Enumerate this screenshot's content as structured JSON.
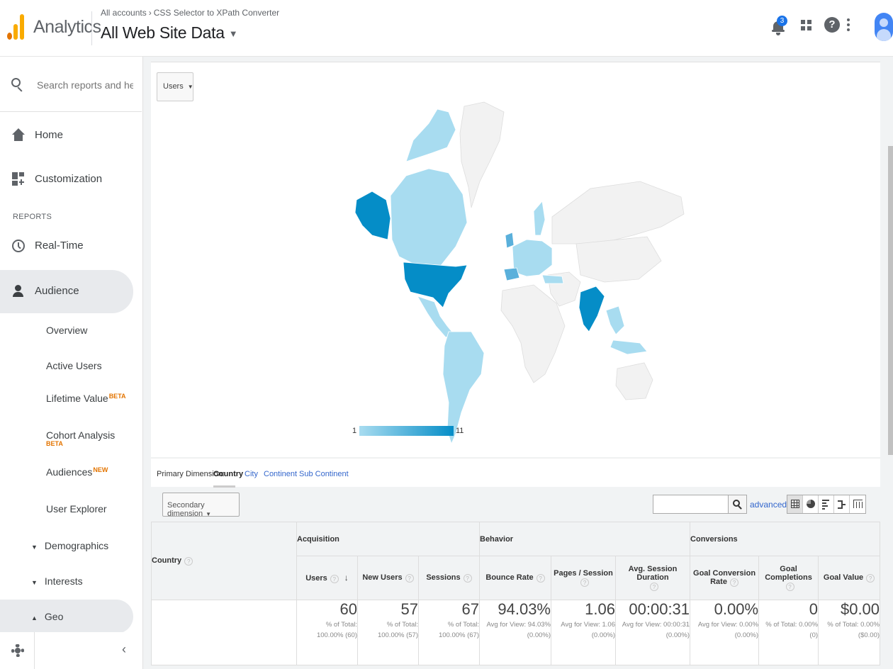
{
  "header": {
    "brand": "Analytics",
    "breadcrumb": [
      "All accounts",
      "CSS Selector to XPath Converter"
    ],
    "breadcrumb_separator": "›",
    "property": "All Web Site Data",
    "notification_count": "3",
    "help_glyph": "?"
  },
  "sidebar": {
    "search_placeholder": "Search reports and help",
    "home": "Home",
    "customization": "Customization",
    "reports_label": "REPORTS",
    "realtime": "Real-Time",
    "audience": "Audience",
    "items": {
      "overview": "Overview",
      "active_users": "Active Users",
      "lifetime_value": "Lifetime Value",
      "lifetime_value_badge": "BETA",
      "cohort_analysis": "Cohort Analysis",
      "cohort_badge": "BETA",
      "audiences": "Audiences",
      "audiences_badge": "NEW",
      "user_explorer": "User Explorer",
      "demographics": "Demographics",
      "interests": "Interests",
      "geo": "Geo"
    },
    "collapse_glyph": "‹"
  },
  "map": {
    "metric": "Users",
    "legend_min": "1",
    "legend_max": "11",
    "colors": {
      "low": "#a8dcf0",
      "high": "#058dc7",
      "none": "#f2f2f2",
      "mid": "#5ab0db"
    }
  },
  "dimension_bar": {
    "label": "Primary Dimension:",
    "current": "Country",
    "options": [
      "City",
      "Continent",
      "Sub Continent"
    ]
  },
  "tools": {
    "secondary_dimension": "Secondary dimension",
    "advanced": "advanced"
  },
  "table": {
    "country_header": "Country",
    "groups": [
      "Acquisition",
      "Behavior",
      "Conversions"
    ],
    "columns": [
      "Users",
      "New Users",
      "Sessions",
      "Bounce Rate",
      "Pages / Session",
      "Avg. Session Duration",
      "Goal Conversion Rate",
      "Goal Completions",
      "Goal Value"
    ],
    "totals": [
      {
        "value": "60",
        "sub1": "% of Total:",
        "sub2": "100.00% (60)"
      },
      {
        "value": "57",
        "sub1": "% of Total:",
        "sub2": "100.00% (57)"
      },
      {
        "value": "67",
        "sub1": "% of Total:",
        "sub2": "100.00% (67)"
      },
      {
        "value": "94.03%",
        "sub1": "Avg for View: 94.03%",
        "sub2": "(0.00%)"
      },
      {
        "value": "1.06",
        "sub1": "Avg for View: 1.06",
        "sub2": "(0.00%)"
      },
      {
        "value": "00:00:31",
        "sub1": "Avg for View: 00:00:31",
        "sub2": "(0.00%)"
      },
      {
        "value": "0.00%",
        "sub1": "Avg for View: 0.00%",
        "sub2": "(0.00%)"
      },
      {
        "value": "0",
        "sub1": "% of Total: 0.00%",
        "sub2": "(0)"
      },
      {
        "value": "$0.00",
        "sub1": "% of Total: 0.00%",
        "sub2": "($0.00)"
      }
    ]
  }
}
